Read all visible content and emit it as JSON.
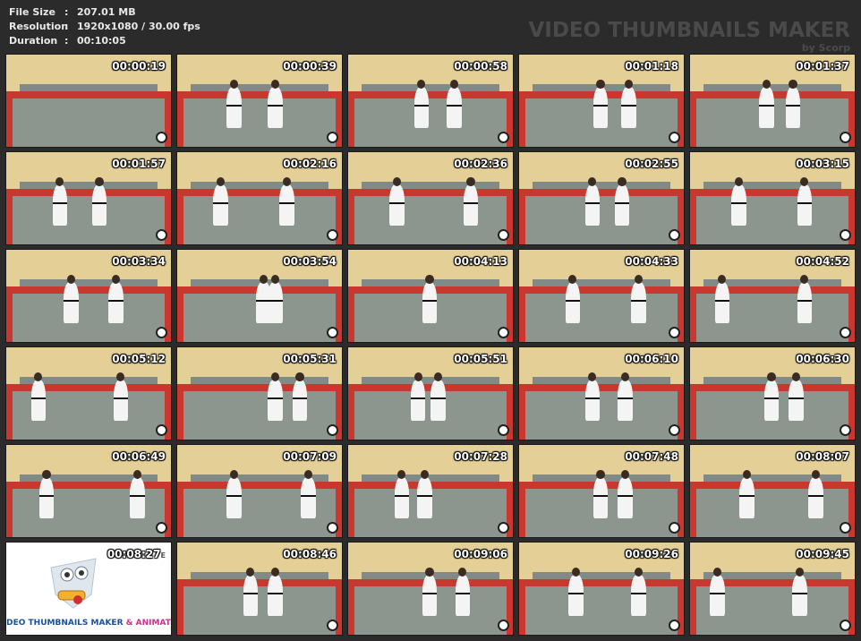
{
  "info": {
    "file_size_label": "File Size",
    "file_size_value": "207.01 MB",
    "resolution_label": "Resolution",
    "resolution_value": "1920x1080 / 30.00 fps",
    "duration_label": "Duration",
    "duration_value": "00:10:05",
    "separator": ":"
  },
  "brand": {
    "title": "VIDEO THUMBNAILS MAKER",
    "subtitle": "by Scorp"
  },
  "logo_tile": {
    "timestamp": "00:08:27",
    "text_main": "DEO THUMBNAILS MAKER",
    "text_accent": " & ANIMAT",
    "edge_char": "E"
  },
  "thumbnails": [
    {
      "time": "00:00:19"
    },
    {
      "time": "00:00:39"
    },
    {
      "time": "00:00:58"
    },
    {
      "time": "00:01:18"
    },
    {
      "time": "00:01:37"
    },
    {
      "time": "00:01:57"
    },
    {
      "time": "00:02:16"
    },
    {
      "time": "00:02:36"
    },
    {
      "time": "00:02:55"
    },
    {
      "time": "00:03:15"
    },
    {
      "time": "00:03:34"
    },
    {
      "time": "00:03:54"
    },
    {
      "time": "00:04:13"
    },
    {
      "time": "00:04:33"
    },
    {
      "time": "00:04:52"
    },
    {
      "time": "00:05:12"
    },
    {
      "time": "00:05:31"
    },
    {
      "time": "00:05:51"
    },
    {
      "time": "00:06:10"
    },
    {
      "time": "00:06:30"
    },
    {
      "time": "00:06:49"
    },
    {
      "time": "00:07:09"
    },
    {
      "time": "00:07:28"
    },
    {
      "time": "00:07:48"
    },
    {
      "time": "00:08:07"
    },
    {
      "time": "00:08:27",
      "logo": true
    },
    {
      "time": "00:08:46"
    },
    {
      "time": "00:09:06"
    },
    {
      "time": "00:09:26"
    },
    {
      "time": "00:09:45"
    }
  ],
  "colors": {
    "background": "#2b2b2b",
    "wall": "#e4cf96",
    "mat_red": "#c8382f",
    "mat_grey": "#8c968e",
    "timestamp_text": "#ffffff"
  }
}
